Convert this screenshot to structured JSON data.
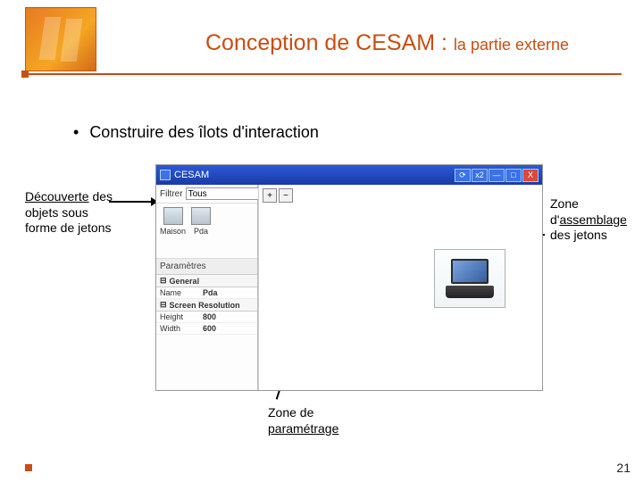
{
  "title": {
    "main": "Conception de CESAM",
    "separator": " : ",
    "sub": "la partie externe"
  },
  "bullet": "Construire des îlots d'interaction",
  "annotations": {
    "left_1": "Découverte",
    "left_2": "des objets sous forme de jetons",
    "right_1": "Zone d'",
    "right_2": "assemblage",
    "right_3": " des jetons",
    "bottom_1": "Zone de ",
    "bottom_2": "paramétrage"
  },
  "app": {
    "title": "CESAM",
    "tbtn_x2": "x2",
    "tbtn_min": "—",
    "tbtn_max": "□",
    "tbtn_close": "X",
    "filter_label": "Filtrer",
    "filter_value": "Tous",
    "zoom_in": "+",
    "zoom_out": "−",
    "tokens": [
      {
        "label": "Maison"
      },
      {
        "label": "Pda"
      }
    ],
    "params_header": "Paramètres",
    "sections": {
      "general": "General",
      "screen": "Screen Resolution"
    },
    "props": {
      "name_k": "Name",
      "name_v": "Pda",
      "height_k": "Height",
      "height_v": "800",
      "width_k": "Width",
      "width_v": "600"
    }
  },
  "page_number": "21"
}
